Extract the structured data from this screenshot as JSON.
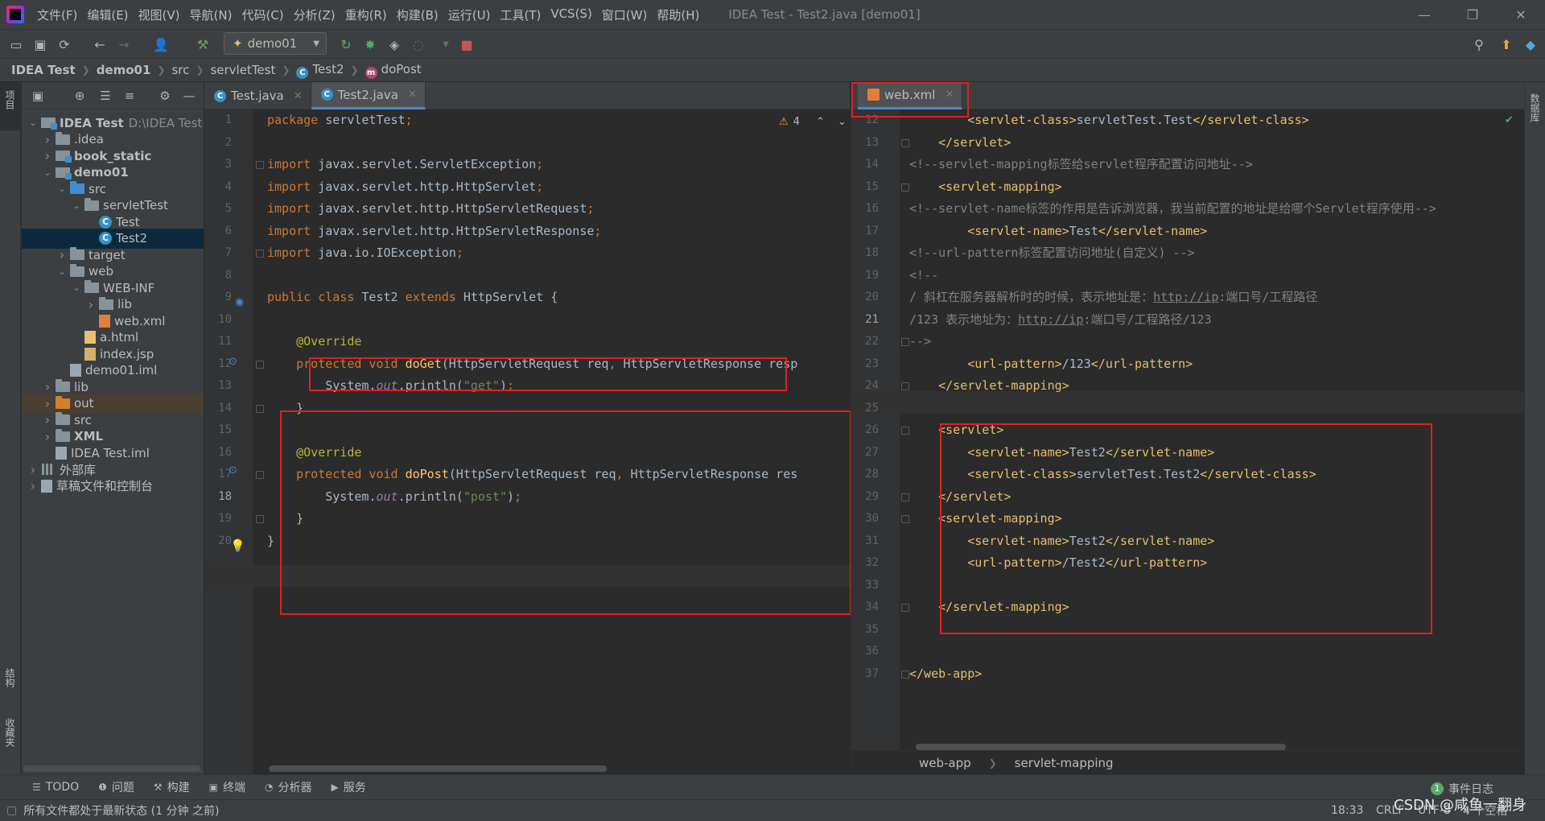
{
  "window": {
    "title": "IDEA Test - Test2.java [demo01]",
    "menu": [
      "文件(F)",
      "编辑(E)",
      "视图(V)",
      "导航(N)",
      "代码(C)",
      "分析(Z)",
      "重构(R)",
      "构建(B)",
      "运行(U)",
      "工具(T)",
      "VCS(S)",
      "窗口(W)",
      "帮助(H)"
    ]
  },
  "toolbar": {
    "run_config": "demo01"
  },
  "breadcrumb": [
    "IDEA Test",
    "demo01",
    "src",
    "servletTest",
    "Test2",
    "doPost"
  ],
  "side_labels": {
    "project": "项目",
    "structure": "结构",
    "favorites": "收藏夹",
    "database": "数据库"
  },
  "project_tree": [
    {
      "label": "IDEA Test",
      "path": "D:\\IDEA Test",
      "depth": 0,
      "arrow": "v",
      "icon": "module",
      "bold": true
    },
    {
      "label": ".idea",
      "depth": 1,
      "arrow": ">",
      "icon": "folder"
    },
    {
      "label": "book_static",
      "depth": 1,
      "arrow": ">",
      "icon": "module",
      "bold": true
    },
    {
      "label": "demo01",
      "depth": 1,
      "arrow": "v",
      "icon": "module",
      "bold": true
    },
    {
      "label": "src",
      "depth": 2,
      "arrow": "v",
      "icon": "folder-blue"
    },
    {
      "label": "servletTest",
      "depth": 3,
      "arrow": "v",
      "icon": "folder"
    },
    {
      "label": "Test",
      "depth": 4,
      "arrow": "",
      "icon": "class"
    },
    {
      "label": "Test2",
      "depth": 4,
      "arrow": "",
      "icon": "class",
      "selected": true
    },
    {
      "label": "target",
      "depth": 2,
      "arrow": ">",
      "icon": "folder"
    },
    {
      "label": "web",
      "depth": 2,
      "arrow": "v",
      "icon": "folder"
    },
    {
      "label": "WEB-INF",
      "depth": 3,
      "arrow": "v",
      "icon": "folder"
    },
    {
      "label": "lib",
      "depth": 4,
      "arrow": ">",
      "icon": "folder"
    },
    {
      "label": "web.xml",
      "depth": 4,
      "arrow": "",
      "icon": "xml"
    },
    {
      "label": "a.html",
      "depth": 3,
      "arrow": "",
      "icon": "html"
    },
    {
      "label": "index.jsp",
      "depth": 3,
      "arrow": "",
      "icon": "jsp"
    },
    {
      "label": "demo01.iml",
      "depth": 2,
      "arrow": "",
      "icon": "iml"
    },
    {
      "label": "lib",
      "depth": 1,
      "arrow": ">",
      "icon": "folder"
    },
    {
      "label": "out",
      "depth": 1,
      "arrow": ">",
      "icon": "folder-orange",
      "excluded": true
    },
    {
      "label": "src",
      "depth": 1,
      "arrow": ">",
      "icon": "folder"
    },
    {
      "label": "XML",
      "depth": 1,
      "arrow": ">",
      "icon": "folder",
      "bold": true
    },
    {
      "label": "IDEA Test.iml",
      "depth": 1,
      "arrow": "",
      "icon": "iml"
    },
    {
      "label": "外部库",
      "depth": 0,
      "arrow": ">",
      "icon": "lib"
    },
    {
      "label": "草稿文件和控制台",
      "depth": 0,
      "arrow": ">",
      "icon": "scratch"
    }
  ],
  "left_editor": {
    "tabs": [
      "Test.java",
      "Test2.java"
    ],
    "active_tab": 1,
    "warning_count": "4",
    "current_line": 18,
    "lines": [
      {
        "n": 1,
        "html": "<span class=\"kw\">package</span> servletTest<span class=\"kw\">;</span>"
      },
      {
        "n": 2,
        "html": ""
      },
      {
        "n": 3,
        "html": "<span class=\"kw\">import</span> javax.servlet.ServletException<span class=\"kw\">;</span>"
      },
      {
        "n": 4,
        "html": "<span class=\"kw\">import</span> javax.servlet.http.HttpServlet<span class=\"kw\">;</span>"
      },
      {
        "n": 5,
        "html": "<span class=\"kw\">import</span> javax.servlet.http.HttpServletRequest<span class=\"kw\">;</span>"
      },
      {
        "n": 6,
        "html": "<span class=\"kw\">import</span> javax.servlet.http.HttpServletResponse<span class=\"kw\">;</span>"
      },
      {
        "n": 7,
        "html": "<span class=\"kw\">import</span> java.io.IOException<span class=\"kw\">;</span>"
      },
      {
        "n": 8,
        "html": ""
      },
      {
        "n": 9,
        "html": "<span class=\"kw\">public class</span> Test2 <span class=\"kw\">extends</span> HttpServlet {"
      },
      {
        "n": 10,
        "html": ""
      },
      {
        "n": 11,
        "html": "    <span class=\"ann\">@Override</span>"
      },
      {
        "n": 12,
        "html": "    <span class=\"kw\">protected void</span> <span class=\"fn\">doGet</span>(HttpServletRequest req<span class=\"kw\">,</span> HttpServletResponse resp"
      },
      {
        "n": 13,
        "html": "        System.<span class=\"it\">out</span>.println(<span class=\"str\">\"get\"</span>)<span class=\"kw\">;</span>"
      },
      {
        "n": 14,
        "html": "    }"
      },
      {
        "n": 15,
        "html": ""
      },
      {
        "n": 16,
        "html": "    <span class=\"ann\">@Override</span>"
      },
      {
        "n": 17,
        "html": "    <span class=\"kw\">protected void</span> <span class=\"fn\">doPost</span>(HttpServletRequest req<span class=\"kw\">,</span> HttpServletResponse res"
      },
      {
        "n": 18,
        "html": "        System.<span class=\"it\">out</span>.println(<span class=\"str\">\"post\"</span>)<span class=\"kw\">;</span>"
      },
      {
        "n": 19,
        "html": "    }"
      },
      {
        "n": 20,
        "html": "}"
      }
    ]
  },
  "right_editor": {
    "tabs": [
      "web.xml"
    ],
    "active_tab": 0,
    "current_line": 21,
    "lines": [
      {
        "n": 12,
        "html": "        <span class=\"tag\">&lt;servlet-class&gt;</span>servletTest.Test<span class=\"tag\">&lt;/servlet-class&gt;</span>"
      },
      {
        "n": 13,
        "html": "    <span class=\"tag\">&lt;/servlet&gt;</span>"
      },
      {
        "n": 14,
        "html": "<span class=\"cmt\">&lt;!--servlet-mapping标签给servlet程序配置访问地址--&gt;</span>"
      },
      {
        "n": 15,
        "html": "    <span class=\"tag\">&lt;servlet-mapping&gt;</span>"
      },
      {
        "n": 16,
        "html": "<span class=\"cmt\">&lt;!--servlet-name标签的作用是告诉浏览器，我当前配置的地址是给哪个Servlet程序使用--&gt;</span>"
      },
      {
        "n": 17,
        "html": "        <span class=\"tag\">&lt;servlet-name&gt;</span>Test<span class=\"tag\">&lt;/servlet-name&gt;</span>"
      },
      {
        "n": 18,
        "html": "<span class=\"cmt\">&lt;!--url-pattern标签配置访问地址(自定义) --&gt;</span>"
      },
      {
        "n": 19,
        "html": "<span class=\"cmt\">&lt;!--</span>"
      },
      {
        "n": 20,
        "html": "<span class=\"cmt\">/ 斜杠在服务器解析时的时候，表示地址是：<span class=\"link\">http://ip</span>:端口号/工程路径</span>"
      },
      {
        "n": 21,
        "html": "<span class=\"cmt\">/123 表示地址为：<span class=\"link\">http://ip</span>:端口号/工程路径/123</span>"
      },
      {
        "n": 22,
        "html": "<span class=\"cmt\">--&gt;</span>"
      },
      {
        "n": 23,
        "html": "        <span class=\"tag\">&lt;url-pattern&gt;</span>/123<span class=\"tag\">&lt;/url-pattern&gt;</span>"
      },
      {
        "n": 24,
        "html": "    <span class=\"tag\">&lt;/servlet-mapping&gt;</span>"
      },
      {
        "n": 25,
        "html": ""
      },
      {
        "n": 26,
        "html": "    <span class=\"tag\">&lt;servlet&gt;</span>"
      },
      {
        "n": 27,
        "html": "        <span class=\"tag\">&lt;servlet-name&gt;</span>Test2<span class=\"tag\">&lt;/servlet-name&gt;</span>"
      },
      {
        "n": 28,
        "html": "        <span class=\"tag\">&lt;servlet-class&gt;</span>servletTest.Test2<span class=\"tag\">&lt;/servlet-class&gt;</span>"
      },
      {
        "n": 29,
        "html": "    <span class=\"tag\">&lt;/servlet&gt;</span>"
      },
      {
        "n": 30,
        "html": "    <span class=\"tag\">&lt;servlet-mapping&gt;</span>"
      },
      {
        "n": 31,
        "html": "        <span class=\"tag\">&lt;servlet-name&gt;</span>Test2<span class=\"tag\">&lt;/servlet-name&gt;</span>"
      },
      {
        "n": 32,
        "html": "        <span class=\"tag\">&lt;url-pattern&gt;</span>/Test2<span class=\"tag\">&lt;/url-pattern&gt;</span>"
      },
      {
        "n": 33,
        "html": ""
      },
      {
        "n": 34,
        "html": "    <span class=\"tag\">&lt;/servlet-mapping&gt;</span>"
      },
      {
        "n": 35,
        "html": ""
      },
      {
        "n": 36,
        "html": ""
      },
      {
        "n": 37,
        "html": "<span class=\"tag\">&lt;/web-app&gt;</span>"
      }
    ],
    "breadcrumb": [
      "web-app",
      "servlet-mapping"
    ]
  },
  "bottom_tools": [
    "TODO",
    "问题",
    "构建",
    "终端",
    "分析器",
    "服务"
  ],
  "event_log": {
    "count": "1",
    "label": "事件日志"
  },
  "status": {
    "message": "所有文件都处于最新状态 (1 分钟 之前)",
    "caret": "18:33",
    "line_sep": "CRLF",
    "encoding": "UTF-8",
    "indent": "4 个空格",
    "watermark": "CSDN @咸鱼一翻身"
  },
  "colors": {
    "keyword": "#cc7832",
    "annotation": "#bbb529",
    "method": "#ffc66d",
    "string": "#6a8759",
    "tag": "#e8bf6a",
    "comment": "#808080",
    "highlight_box": "#e02020"
  }
}
